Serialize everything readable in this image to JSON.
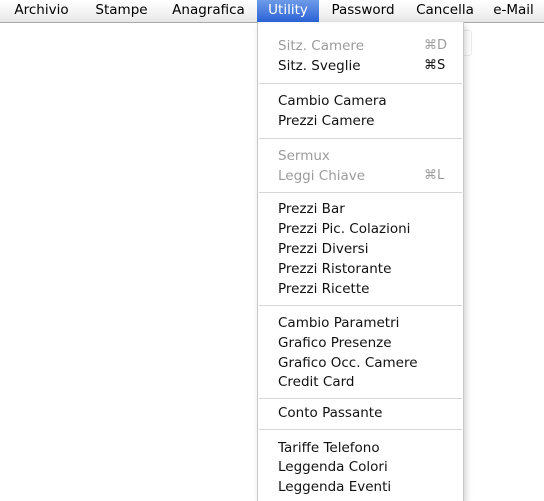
{
  "menubar": {
    "titles": [
      "Archivio",
      "Stampe",
      "Anagrafica",
      "Utility",
      "Password",
      "Cancella",
      "e-Mail"
    ]
  },
  "utility_menu": {
    "items": [
      {
        "label": "Sitz. Camere",
        "shortcut": "⌘D",
        "enabled": false
      },
      {
        "label": "Sitz. Sveglie",
        "shortcut": "⌘S",
        "enabled": true
      },
      {
        "label": "Cambio Camera",
        "enabled": true
      },
      {
        "label": "Prezzi Camere",
        "enabled": true
      },
      {
        "label": "Sermux",
        "enabled": false
      },
      {
        "label": "Leggi Chiave",
        "shortcut": "⌘L",
        "enabled": false
      },
      {
        "label": "Prezzi Bar",
        "enabled": true
      },
      {
        "label": "Prezzi Pic. Colazioni",
        "enabled": true
      },
      {
        "label": "Prezzi Diversi",
        "enabled": true
      },
      {
        "label": "Prezzi Ristorante",
        "enabled": true
      },
      {
        "label": "Prezzi Ricette",
        "enabled": true
      },
      {
        "label": "Cambio Parametri",
        "enabled": true
      },
      {
        "label": "Grafico Presenze",
        "enabled": true
      },
      {
        "label": "Grafico Occ. Camere",
        "enabled": true
      },
      {
        "label": "Credit Card",
        "enabled": true
      },
      {
        "label": "Conto Passante",
        "enabled": true
      },
      {
        "label": "Tariffe Telefono",
        "enabled": true
      },
      {
        "label": "Leggenda Colori",
        "enabled": true
      },
      {
        "label": "Leggenda Eventi",
        "enabled": true
      }
    ]
  },
  "colors": {
    "highlight": "#2b63d6",
    "disabled_text": "#9c9c9c"
  }
}
